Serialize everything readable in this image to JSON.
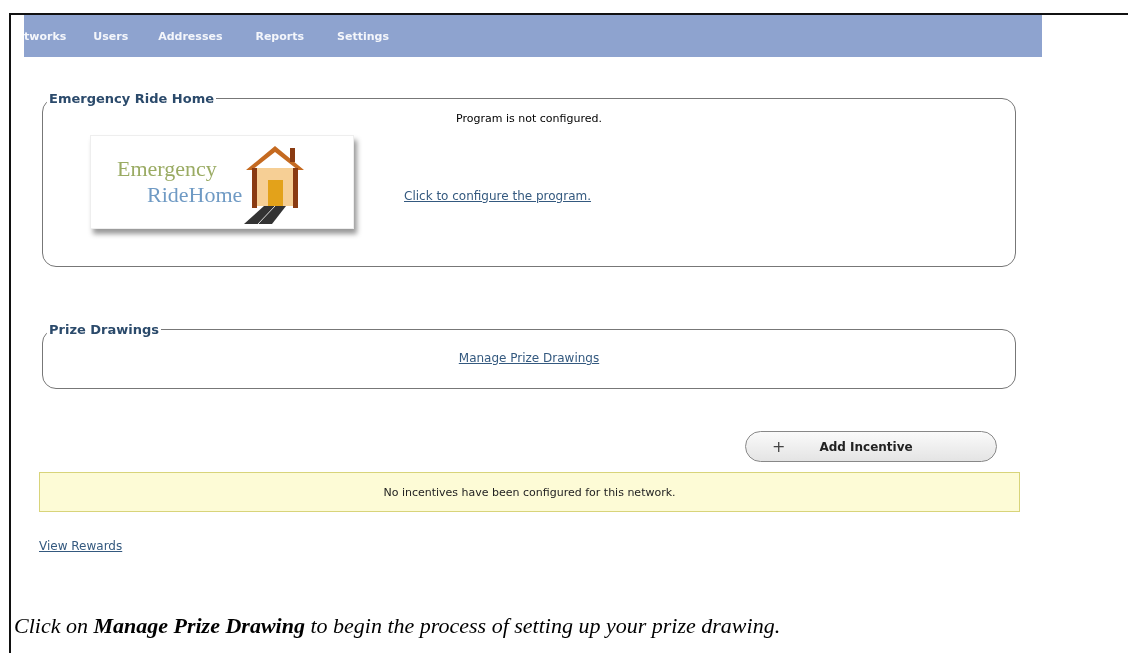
{
  "nav": {
    "items": [
      {
        "label": "tworks"
      },
      {
        "label": "Users"
      },
      {
        "label": "Addresses"
      },
      {
        "label": "Reports"
      },
      {
        "label": "Settings"
      }
    ]
  },
  "emergency_ride_home": {
    "title": "Emergency Ride Home",
    "status": "Program is not configured.",
    "logo": {
      "line_1": "Emergency",
      "line_2": "RideHome"
    },
    "link": "Click to configure the program."
  },
  "prize_drawings": {
    "title": "Prize Drawings",
    "link": "Manage Prize Drawings"
  },
  "add_button": {
    "icon": "+",
    "label": "Add Incentive"
  },
  "notice": "No incentives have been configured for this network.",
  "view_rewards": "View Rewards",
  "caption": "Click on **Manage Prize Drawing** to begin the process of setting up your prize drawing."
}
